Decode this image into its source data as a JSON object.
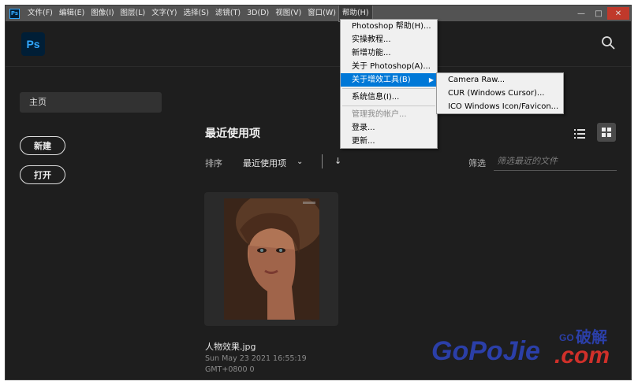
{
  "menubar": {
    "items": [
      "文件(F)",
      "编辑(E)",
      "图像(I)",
      "图层(L)",
      "文字(Y)",
      "选择(S)",
      "滤镜(T)",
      "3D(D)",
      "视图(V)",
      "窗口(W)",
      "帮助(H)"
    ],
    "app_icon": "Ps",
    "minimize": "—",
    "maximize": "□",
    "close": "✕"
  },
  "header": {
    "logo": "Ps"
  },
  "sidebar": {
    "home": "主页",
    "new_button": "新建",
    "open_button": "打开"
  },
  "main": {
    "title": "最近使用项",
    "sort_label": "排序",
    "sort_value": "最近使用项",
    "sort_chevron": "⌄",
    "sort_direction": "↓",
    "filter_label": "筛选",
    "filter_placeholder": "筛选最近的文件",
    "file": {
      "name": "人物效果.jpg",
      "date": "Sun May 23 2021 16:55:19 GMT+0800 0"
    }
  },
  "help_menu": {
    "items": [
      {
        "label": "Photoshop 帮助(H)..."
      },
      {
        "label": "实操教程..."
      },
      {
        "label": "新增功能..."
      },
      {
        "label": "关于 Photoshop(A)..."
      },
      {
        "label": "关于增效工具(B)"
      },
      {
        "label": "系统信息(I)..."
      },
      {
        "label": "管理我的帐户..."
      },
      {
        "label": "登录..."
      },
      {
        "label": "更新..."
      }
    ]
  },
  "plugins_submenu": {
    "items": [
      "Camera Raw...",
      "CUR (Windows Cursor)...",
      "ICO Windows Icon/Favicon..."
    ]
  },
  "watermark": {
    "text_main": "GoPoJie.com",
    "text_prefix": "GO",
    "text_cn": "破解"
  }
}
